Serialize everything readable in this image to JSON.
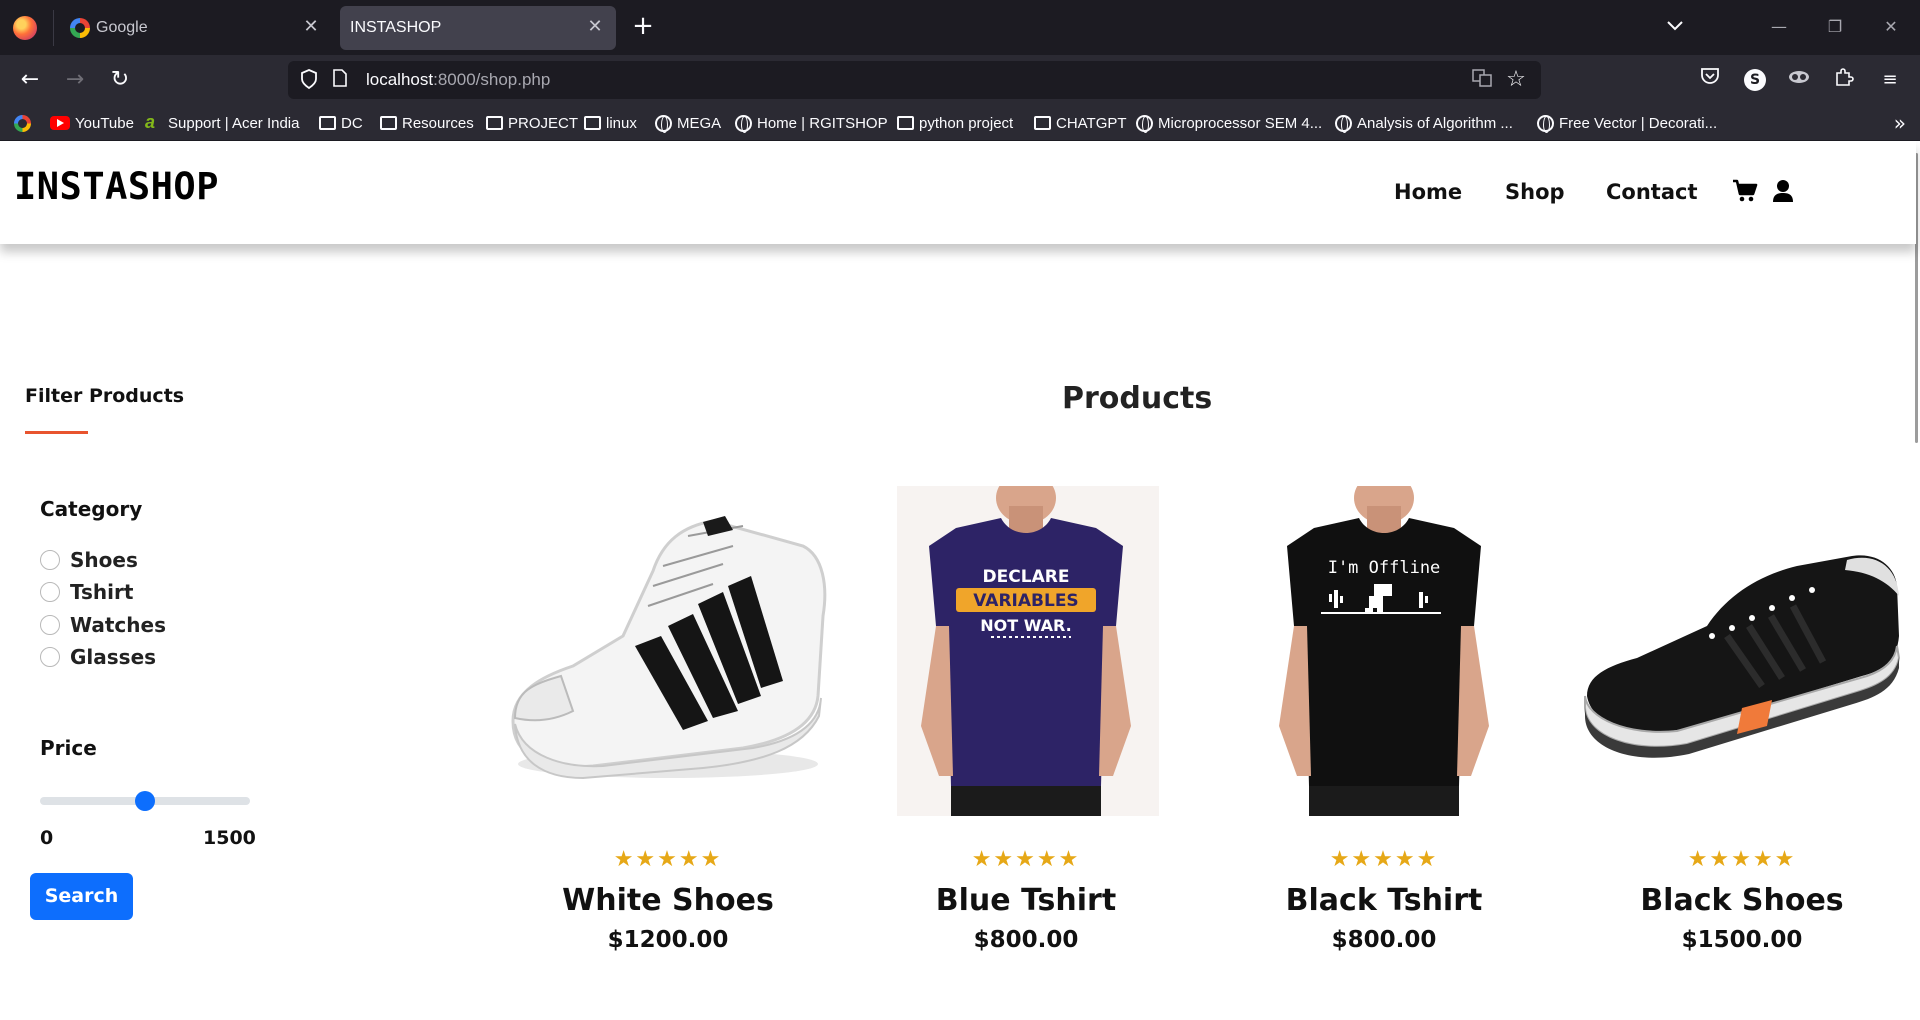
{
  "browser": {
    "tabs": [
      {
        "title": "Google",
        "active": false
      },
      {
        "title": "INSTASHOP",
        "active": true
      }
    ],
    "url_host": "localhost",
    "url_rest": ":8000/shop.php",
    "bookmarks": [
      {
        "label": "",
        "icon": "google-icon"
      },
      {
        "label": "YouTube",
        "icon": "youtube-icon"
      },
      {
        "label": "Support | Acer India",
        "icon": "acer-icon"
      },
      {
        "label": "DC",
        "icon": "folder-icon"
      },
      {
        "label": "Resources",
        "icon": "folder-icon"
      },
      {
        "label": "PROJECT",
        "icon": "folder-icon"
      },
      {
        "label": "linux",
        "icon": "folder-icon"
      },
      {
        "label": "MEGA",
        "icon": "globe-icon"
      },
      {
        "label": "Home | RGITSHOP",
        "icon": "globe-icon"
      },
      {
        "label": "python project",
        "icon": "folder-icon"
      },
      {
        "label": "CHATGPT",
        "icon": "folder-icon"
      },
      {
        "label": "Microprocessor SEM 4...",
        "icon": "globe-icon"
      },
      {
        "label": "Analysis of Algorithm ...",
        "icon": "globe-icon"
      },
      {
        "label": "Free Vector | Decorati...",
        "icon": "globe-icon"
      }
    ]
  },
  "site": {
    "brand": "INSTASHOP",
    "nav": [
      "Home",
      "Shop",
      "Contact"
    ],
    "icons": [
      "cart-icon",
      "user-icon"
    ]
  },
  "filters": {
    "title": "Filter Products",
    "category_title": "Category",
    "categories": [
      "Shoes",
      "Tshirt",
      "Watches",
      "Glasses"
    ],
    "price_title": "Price",
    "price_min": "0",
    "price_max": "1500",
    "slider_value": 0.5,
    "search_label": "Search"
  },
  "products": {
    "title": "Products",
    "rating_stars": "★★★★★",
    "items": [
      {
        "name": "White Shoes",
        "price": "$1200.00",
        "image": "white-sneaker-image"
      },
      {
        "name": "Blue Tshirt",
        "price": "$800.00",
        "image": "blue-tshirt-image"
      },
      {
        "name": "Black Tshirt",
        "price": "$800.00",
        "image": "black-tshirt-image"
      },
      {
        "name": "Black Shoes",
        "price": "$1500.00",
        "image": "black-sneaker-image"
      }
    ],
    "tshirt_texts": {
      "blue_line1": "DECLARE",
      "blue_line2": "VARIABLES",
      "blue_line3": "NOT WAR.",
      "black": "I'm Offline"
    }
  },
  "colors": {
    "accent": "#0d6efd",
    "underline": "#e8542e",
    "stars": "#e6a817",
    "blue_tshirt": "#2d2366",
    "black_tshirt": "#101010"
  }
}
